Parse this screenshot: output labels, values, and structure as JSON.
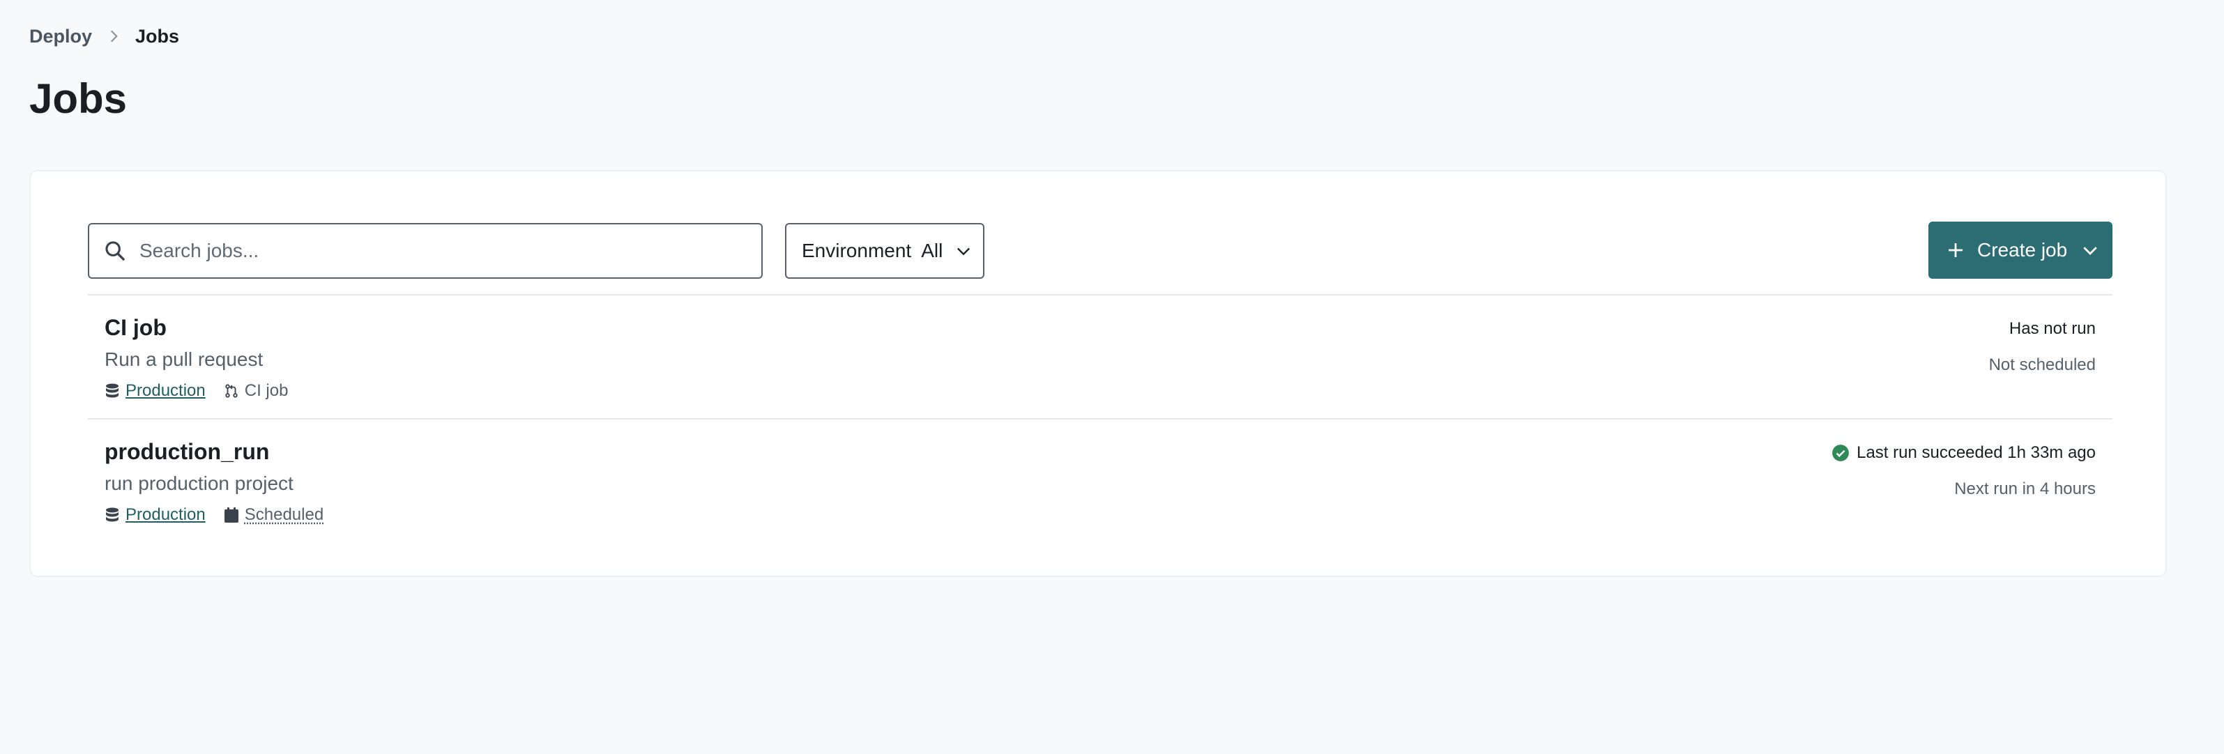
{
  "breadcrumb": {
    "parent": "Deploy",
    "current": "Jobs"
  },
  "page": {
    "title": "Jobs"
  },
  "toolbar": {
    "search_placeholder": "Search jobs...",
    "environment_label": "Environment",
    "environment_value": "All",
    "create_label": "Create job"
  },
  "jobs": [
    {
      "name": "CI job",
      "description": "Run a pull request",
      "environment": "Production",
      "trigger": "CI job",
      "trigger_icon": "pull-request-icon",
      "status": "Has not run",
      "schedule": "Not scheduled"
    },
    {
      "name": "production_run",
      "description": "run production project",
      "environment": "Production",
      "trigger": "Scheduled",
      "trigger_icon": "calendar-icon",
      "status": "Last run succeeded 1h 33m ago",
      "schedule": "Next run in 4 hours"
    }
  ],
  "colors": {
    "accent": "#2b6d72",
    "success": "#2e8a57",
    "link": "#1f5f63"
  }
}
